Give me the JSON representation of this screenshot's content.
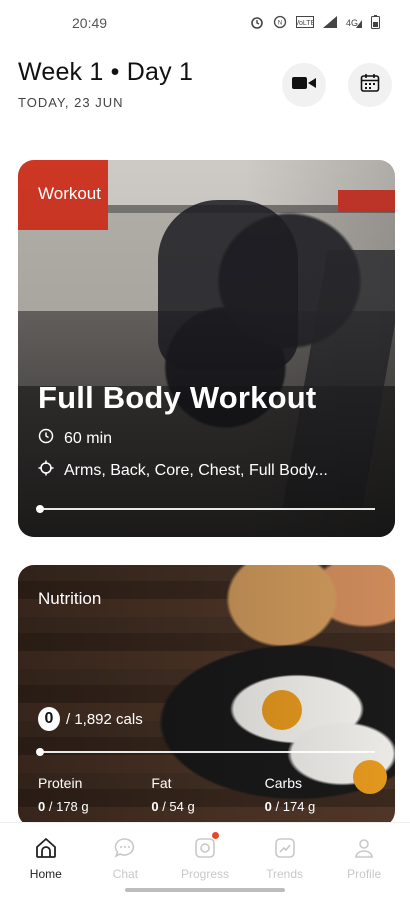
{
  "status_bar": {
    "time": "20:49",
    "icons": [
      "alarm-icon",
      "nfc-icon",
      "volte-icon",
      "signal-icon",
      "data-4g-icon",
      "battery-icon"
    ]
  },
  "header": {
    "title": "Week 1 • Day 1",
    "date": "TODAY, 23 JUN",
    "buttons": [
      "video-icon",
      "calendar-icon"
    ]
  },
  "workout_card": {
    "label": "Workout",
    "title": "Full Body Workout",
    "duration": "60 min",
    "muscles": "Arms, Back, Core, Chest, Full Body...",
    "progress": 0
  },
  "nutrition_card": {
    "label": "Nutrition",
    "calories_consumed": "0",
    "calories_target": "/ 1,892 cals",
    "progress": 0,
    "macros": [
      {
        "name": "Protein",
        "consumed": "0",
        "target": "/ 178 g"
      },
      {
        "name": "Fat",
        "consumed": "0",
        "target": "/ 54 g"
      },
      {
        "name": "Carbs",
        "consumed": "0",
        "target": "/ 174 g"
      }
    ]
  },
  "bottom_nav": {
    "active": "Home",
    "items": [
      {
        "label": "Home",
        "icon": "home-icon"
      },
      {
        "label": "Chat",
        "icon": "chat-icon"
      },
      {
        "label": "Progress",
        "icon": "camera-icon",
        "badge": true
      },
      {
        "label": "Trends",
        "icon": "trends-icon"
      },
      {
        "label": "Profile",
        "icon": "profile-icon"
      }
    ]
  },
  "colors": {
    "accent_red": "#e8452c",
    "text_dark": "#111111",
    "nav_inactive": "#c8c8c8"
  }
}
